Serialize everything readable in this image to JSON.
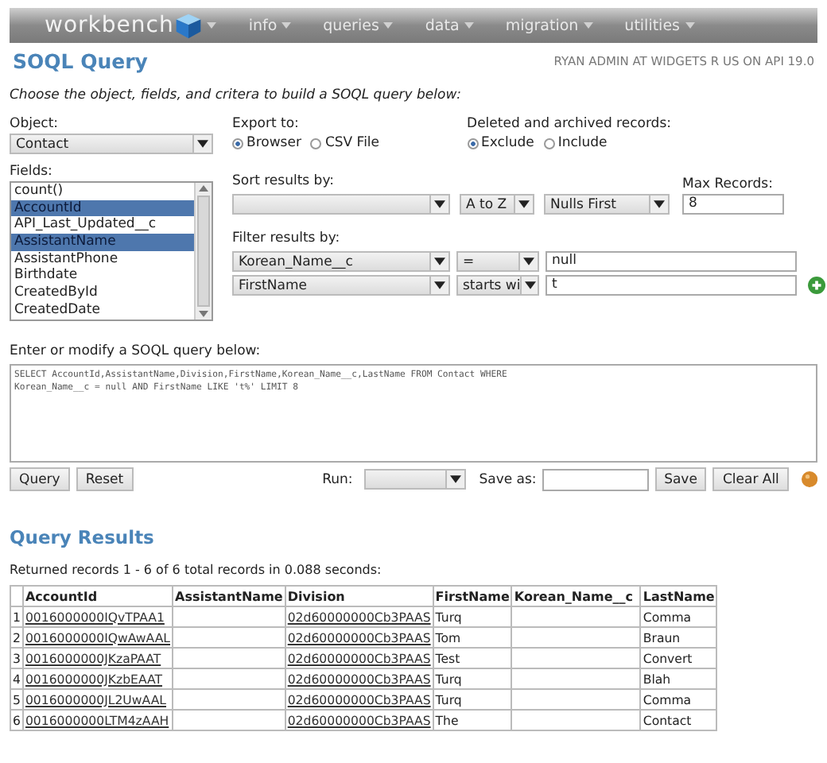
{
  "nav": {
    "logo": "workbench",
    "menus": [
      {
        "label": "info"
      },
      {
        "label": "queries"
      },
      {
        "label": "data"
      },
      {
        "label": "migration"
      },
      {
        "label": "utilities"
      }
    ]
  },
  "page_title": "SOQL Query",
  "user_info": "RYAN ADMIN AT WIDGETS R US ON API 19.0",
  "instructions": "Choose the object, fields, and critera to build a SOQL query below:",
  "object": {
    "label": "Object:",
    "value": "Contact"
  },
  "export": {
    "label": "Export to:",
    "options": [
      {
        "label": "Browser",
        "selected": true
      },
      {
        "label": "CSV File",
        "selected": false
      }
    ]
  },
  "deleted": {
    "label": "Deleted and archived records:",
    "options": [
      {
        "label": "Exclude",
        "selected": true
      },
      {
        "label": "Include",
        "selected": false
      }
    ]
  },
  "fields": {
    "label": "Fields:",
    "items": [
      {
        "label": "count()",
        "selected": false
      },
      {
        "label": "AccountId",
        "selected": true
      },
      {
        "label": "API_Last_Updated__c",
        "selected": false
      },
      {
        "label": "AssistantName",
        "selected": true
      },
      {
        "label": "AssistantPhone",
        "selected": false
      },
      {
        "label": "Birthdate",
        "selected": false
      },
      {
        "label": "CreatedById",
        "selected": false
      },
      {
        "label": "CreatedDate",
        "selected": false
      }
    ]
  },
  "sort": {
    "label": "Sort results by:",
    "order": "A to Z",
    "nulls": "Nulls First"
  },
  "max_records": {
    "label": "Max Records:",
    "value": "8"
  },
  "filter": {
    "label": "Filter results by:",
    "rows": [
      {
        "field": "Korean_Name__c",
        "operator": "=",
        "value": "null"
      },
      {
        "field": "FirstName",
        "operator": "starts wi",
        "value": "t"
      }
    ]
  },
  "query": {
    "label": "Enter or modify a SOQL query below:",
    "lines": [
      "SELECT AccountId,AssistantName,Division,FirstName,Korean_Name__c,LastName FROM Contact WHERE",
      "Korean_Name__c = null AND FirstName LIKE 't%' LIMIT 8"
    ]
  },
  "actions": {
    "query_button": "Query",
    "reset_button": "Reset",
    "run_label": "Run:",
    "save_as_label": "Save as:",
    "save_button": "Save",
    "clear_button": "Clear All"
  },
  "results": {
    "title": "Query Results",
    "summary": "Returned records 1 - 6 of 6 total records in 0.088 seconds:",
    "columns": [
      "AccountId",
      "AssistantName",
      "Division",
      "FirstName",
      "Korean_Name__c",
      "LastName"
    ],
    "rows": [
      {
        "num": "1",
        "cells": [
          "0016000000IQvTPAA1",
          "",
          "02d60000000Cb3PAAS",
          "Turq",
          "",
          "Comma"
        ]
      },
      {
        "num": "2",
        "cells": [
          "0016000000IQwAwAAL",
          "",
          "02d60000000Cb3PAAS",
          "Tom",
          "",
          "Braun"
        ]
      },
      {
        "num": "3",
        "cells": [
          "0016000000JKzaPAAT",
          "",
          "02d60000000Cb3PAAS",
          "Test",
          "",
          "Convert"
        ]
      },
      {
        "num": "4",
        "cells": [
          "0016000000JKzbEAAT",
          "",
          "02d60000000Cb3PAAS",
          "Turq",
          "",
          "Blah"
        ]
      },
      {
        "num": "5",
        "cells": [
          "0016000000JL2UwAAL",
          "",
          "02d60000000Cb3PAAS",
          "Turq",
          "",
          "Comma"
        ]
      },
      {
        "num": "6",
        "cells": [
          "0016000000LTM4zAAH",
          "",
          "02d60000000Cb3PAAS",
          "The",
          "",
          "Contact"
        ]
      }
    ]
  }
}
